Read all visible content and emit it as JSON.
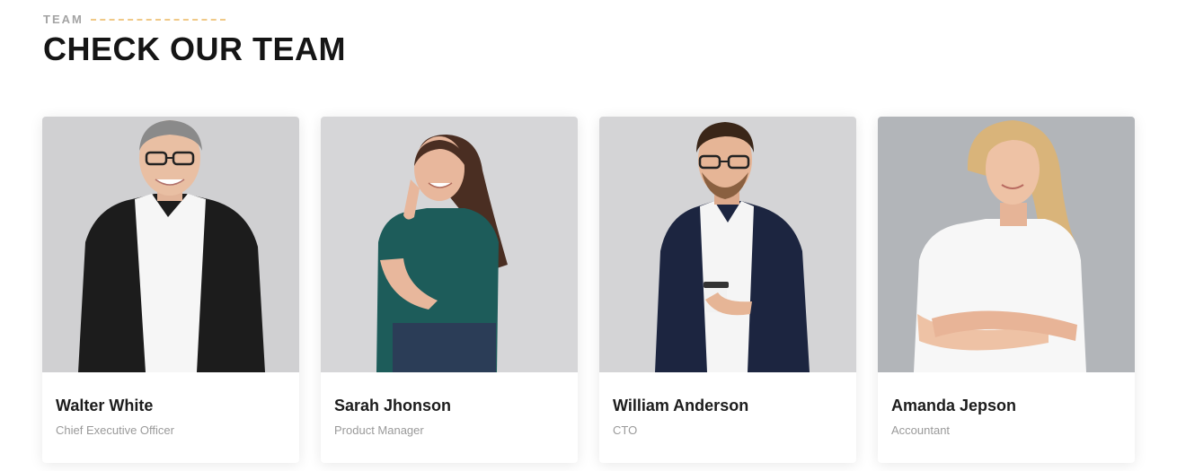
{
  "section": {
    "eyebrow": "TEAM",
    "title": "CHECK OUR TEAM"
  },
  "members": [
    {
      "name": "Walter White",
      "role": "Chief Executive Officer",
      "photo_bg": "#d0d0d2",
      "jacket": "#1c1c1c",
      "shirt": "#f6f6f6",
      "hair": "#8a8a8a",
      "skin": "#e9bfa3"
    },
    {
      "name": "Sarah Jhonson",
      "role": "Product Manager",
      "photo_bg": "#d6d6d8",
      "top": "#1d5c5a",
      "jeans": "#2b3d57",
      "hair": "#4a2e22",
      "skin": "#e8b79c"
    },
    {
      "name": "William Anderson",
      "role": "CTO",
      "photo_bg": "#d4d4d6",
      "jacket": "#1c2540",
      "shirt": "#f5f5f5",
      "hair": "#3a2618",
      "skin": "#e6b596"
    },
    {
      "name": "Amanda Jepson",
      "role": "Accountant",
      "photo_bg": "#b2b5b9",
      "blouse": "#f7f7f7",
      "hair": "#d9b47a",
      "skin": "#eec2a5"
    }
  ]
}
